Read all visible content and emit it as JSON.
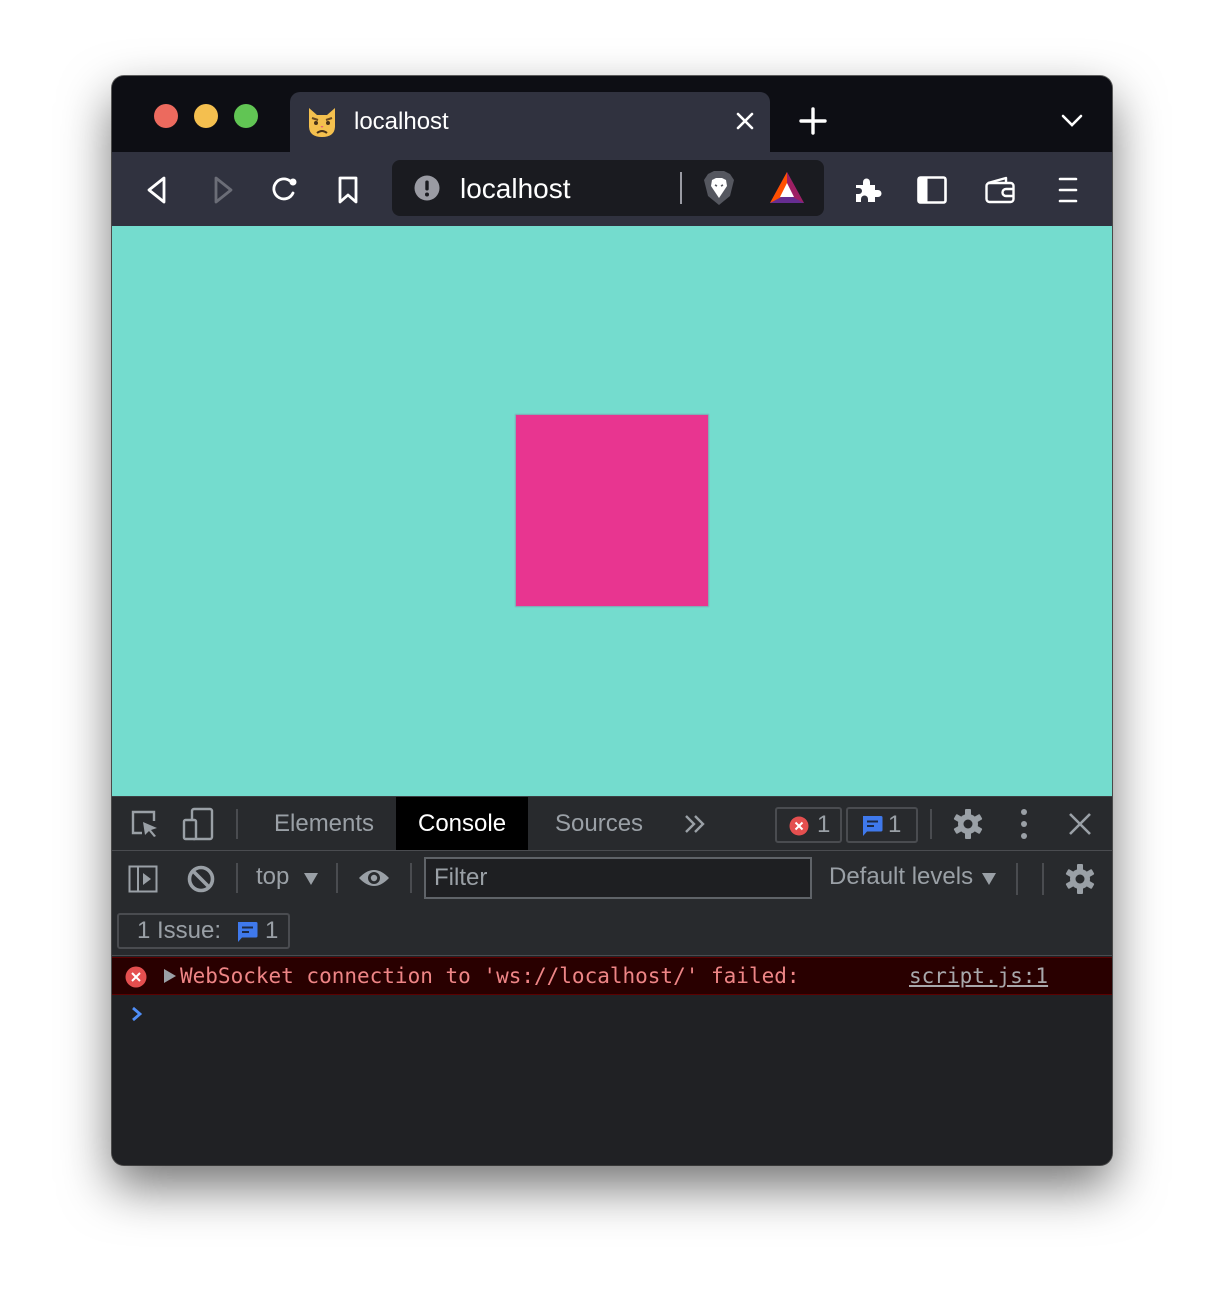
{
  "browser": {
    "tab": {
      "title": "localhost",
      "favicon": "pouting-cat-icon"
    },
    "address_bar": {
      "url": "localhost",
      "security_icon": "info-icon"
    },
    "toolbar_icons": [
      "back-icon",
      "forward-icon",
      "reload-icon",
      "bookmark-icon",
      "brave-shields-icon",
      "brave-rewards-icon",
      "extensions-icon",
      "sidebar-icon",
      "wallet-icon",
      "menu-icon"
    ]
  },
  "page": {
    "background_color": "#74dcce",
    "box_color": "#e83590"
  },
  "devtools": {
    "tabs": [
      {
        "label": "Elements",
        "active": false
      },
      {
        "label": "Console",
        "active": true
      },
      {
        "label": "Sources",
        "active": false
      }
    ],
    "more_tabs": "»",
    "error_count": "1",
    "issue_count": "1",
    "console_toolbar": {
      "context": "top",
      "filter_placeholder": "Filter",
      "levels": "Default levels"
    },
    "issues": {
      "label": "1 Issue:",
      "count": "1"
    },
    "messages": [
      {
        "level": "error",
        "text": "WebSocket connection to 'ws://localhost/' failed:",
        "source": "script.js:1"
      }
    ],
    "prompt": "›"
  }
}
